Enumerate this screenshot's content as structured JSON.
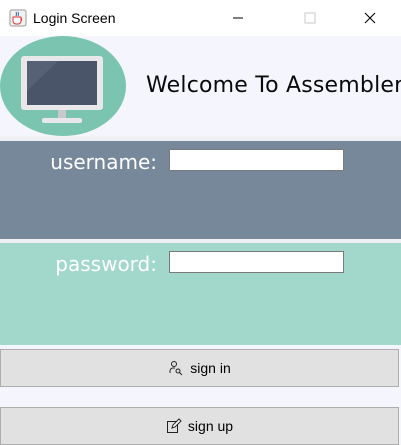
{
  "window": {
    "title": "Login Screen",
    "icon": "java-cup-icon"
  },
  "header": {
    "welcome": "Welcome To Assembler!",
    "icon": "monitor-icon"
  },
  "form": {
    "username": {
      "label": "username:",
      "value": ""
    },
    "password": {
      "label": "password:",
      "value": ""
    }
  },
  "buttons": {
    "sign_in": {
      "label": "sign in",
      "icon": "user-key-icon"
    },
    "sign_up": {
      "label": "sign up",
      "icon": "edit-icon"
    }
  },
  "colors": {
    "username_panel": "#78889b",
    "password_panel": "#a2d8cc",
    "background": "#f5f6fd",
    "monitor_circle": "#7bc4af"
  }
}
